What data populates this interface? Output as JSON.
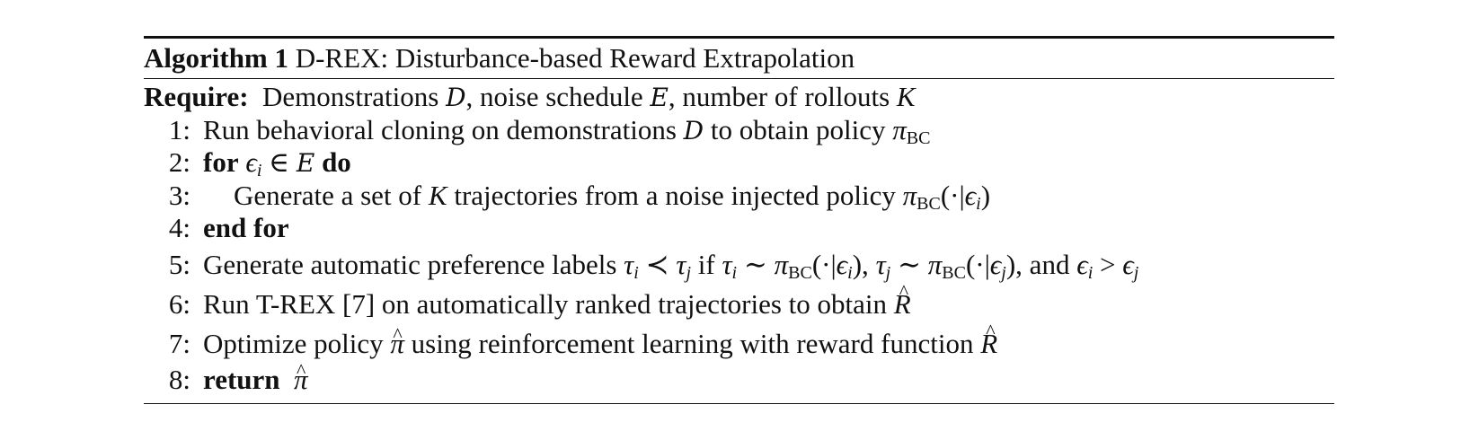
{
  "algorithm": {
    "label": "Algorithm 1",
    "title": "D-REX: Disturbance-based Reward Extrapolation",
    "require": {
      "label": "Require:",
      "text_1": "Demonstrations",
      "D": "D",
      "text_2": ", noise schedule",
      "E": "E",
      "text_3": ", number of rollouts",
      "K": "K"
    },
    "lines": {
      "l1": {
        "num": "1:",
        "text_1": "Run behavioral cloning on demonstrations",
        "D": "D",
        "text_2": "to obtain policy",
        "pi": "π",
        "sub": "BC"
      },
      "l2": {
        "num": "2:",
        "kw_for": "for",
        "eps": "ϵ",
        "i": "i",
        "in": "∈",
        "E": "E",
        "kw_do": "do"
      },
      "l3": {
        "num": "3:",
        "text_1": "Generate a set of",
        "K": "K",
        "text_2": "trajectories from a noise injected policy",
        "pi": "π",
        "sub": "BC",
        "args": "(·|",
        "eps": "ϵ",
        "i": "i",
        "close": ")"
      },
      "l4": {
        "num": "4:",
        "kw": "end for"
      },
      "l5": {
        "num": "5:",
        "text_1": "Generate automatic preference labels",
        "tau": "τ",
        "i": "i",
        "prec": "≺",
        "j": "j",
        "text_if": "if",
        "sim": "∼",
        "pi": "π",
        "sub": "BC",
        "args": "(·|",
        "eps": "ϵ",
        "close_comma": "),",
        "text_and": "), and",
        "gt": ">"
      },
      "l6": {
        "num": "6:",
        "text_1": "Run T-REX [7] on automatically ranked trajectories to obtain",
        "R": "R"
      },
      "l7": {
        "num": "7:",
        "text_1": "Optimize policy",
        "pi": "π",
        "text_2": "using reinforcement learning with reward function",
        "R": "R"
      },
      "l8": {
        "num": "8:",
        "kw": "return",
        "pi": "π"
      }
    }
  }
}
